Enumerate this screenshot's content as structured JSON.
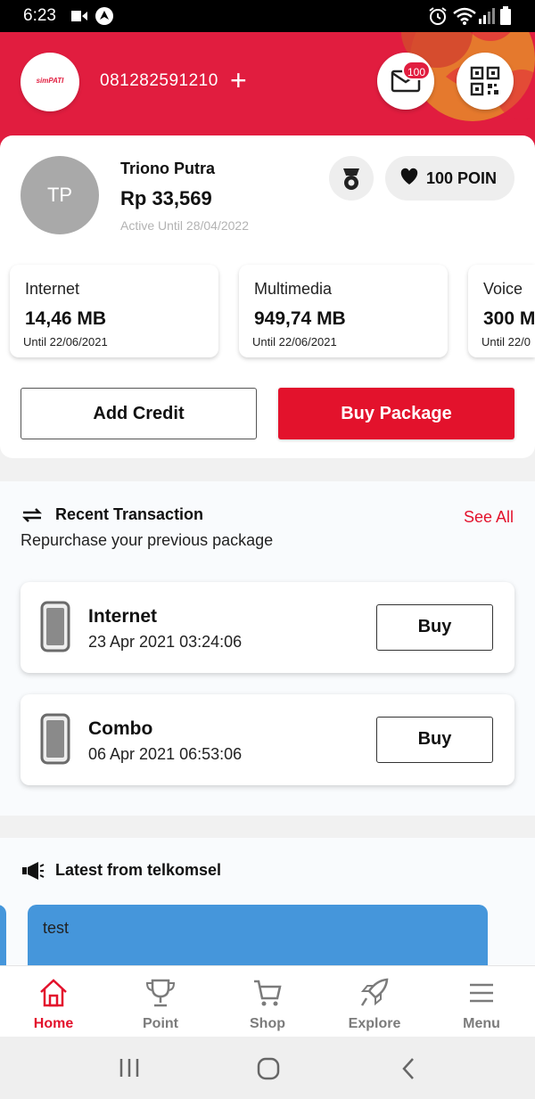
{
  "status_bar": {
    "time": "6:23"
  },
  "header": {
    "logo_text": "simPATI",
    "phone_number": "081282591210",
    "add_number_symbol": "+",
    "mail_badge": "100"
  },
  "profile": {
    "initials": "TP",
    "name": "Triono Putra",
    "balance": "Rp 33,569",
    "active_until": "Active Until 28/04/2022",
    "poin_label": "100 POIN"
  },
  "quotas": [
    {
      "title": "Internet",
      "value": "14,46 MB",
      "until": "Until 22/06/2021"
    },
    {
      "title": "Multimedia",
      "value": "949,74 MB",
      "until": "Until 22/06/2021"
    },
    {
      "title": "Voice",
      "value": "300 M",
      "until": "Until 22/0"
    }
  ],
  "actions": {
    "add_credit": "Add Credit",
    "buy_package": "Buy Package"
  },
  "recent": {
    "title": "Recent Transaction",
    "subtitle": "Repurchase your previous package",
    "see_all": "See All",
    "items": [
      {
        "name": "Internet",
        "date": "23 Apr 2021 03:24:06",
        "button": "Buy"
      },
      {
        "name": "Combo",
        "date": "06 Apr 2021 06:53:06",
        "button": "Buy"
      }
    ]
  },
  "latest": {
    "title": "Latest from telkomsel",
    "promo_text": "test"
  },
  "nav": {
    "items": [
      {
        "label": "Home",
        "icon": "home-icon"
      },
      {
        "label": "Point",
        "icon": "trophy-icon"
      },
      {
        "label": "Shop",
        "icon": "cart-icon"
      },
      {
        "label": "Explore",
        "icon": "rocket-icon"
      },
      {
        "label": "Menu",
        "icon": "hamburger-icon"
      }
    ]
  },
  "colors": {
    "brand_red": "#e3122c",
    "header_red": "#e11d3f",
    "promo_blue": "#4596db"
  }
}
